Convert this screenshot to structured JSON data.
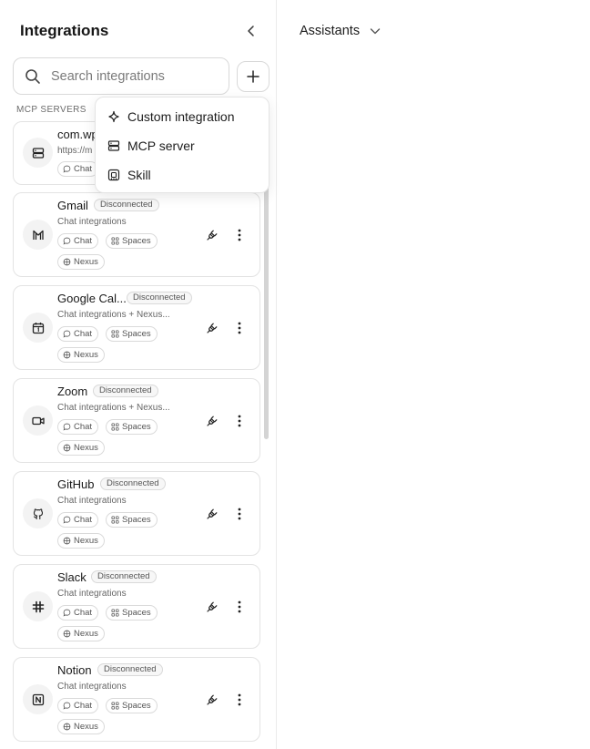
{
  "sidebar": {
    "title": "Integrations",
    "search": {
      "placeholder": "Search integrations",
      "value": ""
    },
    "section_label": "MCP SERVERS",
    "first_item": {
      "name": "com.wp",
      "desc": "https://m",
      "tag": "Chat"
    },
    "items": [
      {
        "name": "Gmail",
        "status": "Disconnected",
        "desc": "Chat integrations",
        "tags": [
          "Chat",
          "Spaces",
          "Nexus"
        ],
        "icon": "gmail-icon"
      },
      {
        "name": "Google Cal...",
        "status": "Disconnected",
        "desc": "Chat integrations + Nexus...",
        "tags": [
          "Chat",
          "Spaces",
          "Nexus"
        ],
        "icon": "calendar-icon"
      },
      {
        "name": "Zoom",
        "status": "Disconnected",
        "desc": "Chat integrations + Nexus...",
        "tags": [
          "Chat",
          "Spaces",
          "Nexus"
        ],
        "icon": "video-icon"
      },
      {
        "name": "GitHub",
        "status": "Disconnected",
        "desc": "Chat integrations",
        "tags": [
          "Chat",
          "Spaces",
          "Nexus"
        ],
        "icon": "github-icon"
      },
      {
        "name": "Slack",
        "status": "Disconnected",
        "desc": "Chat integrations",
        "tags": [
          "Chat",
          "Spaces",
          "Nexus"
        ],
        "icon": "slack-icon"
      },
      {
        "name": "Notion",
        "status": "Disconnected",
        "desc": "Chat integrations",
        "tags": [
          "Chat",
          "Spaces",
          "Nexus"
        ],
        "icon": "notion-icon"
      }
    ]
  },
  "dropdown": {
    "items": [
      {
        "label": "Custom integration",
        "icon": "sparkle-icon"
      },
      {
        "label": "MCP server",
        "icon": "server-icon"
      },
      {
        "label": "Skill",
        "icon": "skill-icon"
      }
    ]
  },
  "main": {
    "assistants_label": "Assistants"
  }
}
